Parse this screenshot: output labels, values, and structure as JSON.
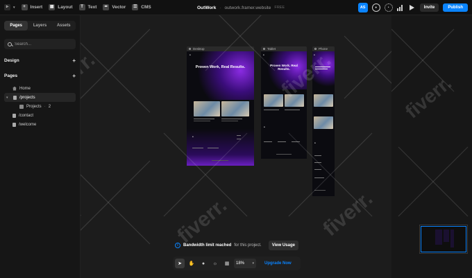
{
  "topbar": {
    "menu": [
      {
        "label": "Insert",
        "icon": "plus-icon"
      },
      {
        "label": "Layout",
        "icon": "layout-icon"
      },
      {
        "label": "Text",
        "icon": "text-icon"
      },
      {
        "label": "Vector",
        "icon": "vector-icon"
      },
      {
        "label": "CMS",
        "icon": "cms-icon"
      }
    ],
    "project_name": "OutWork",
    "domain": "outwork.framer.website",
    "plan": "FREE",
    "avatar": "AS",
    "invite_label": "Invite",
    "publish_label": "Publish"
  },
  "sidebar": {
    "tabs": [
      "Pages",
      "Layers",
      "Assets"
    ],
    "active_tab": "Pages",
    "search_placeholder": "Search...",
    "design_label": "Design",
    "pages_label": "Pages",
    "pages": [
      {
        "label": "Home",
        "icon": "home-icon"
      },
      {
        "label": "/projects",
        "icon": "page-icon",
        "expanded": true,
        "active": true
      },
      {
        "label": "Projects",
        "count": "2",
        "icon": "cms-collection-icon"
      },
      {
        "label": "/contact",
        "icon": "page-icon"
      },
      {
        "label": "/welcome",
        "icon": "page-icon"
      }
    ]
  },
  "canvas": {
    "frames": [
      {
        "label": "Desktop",
        "hero_title": "Proven Work, Real Results."
      },
      {
        "label": "Tablet",
        "hero_title": "Proven Work. Real Results."
      },
      {
        "label": "Phone"
      }
    ]
  },
  "bandwidth": {
    "message_bold": "Bandwidth limit reached",
    "message_rest": "for this project.",
    "button_label": "View Usage"
  },
  "toolbar": {
    "zoom": "18%",
    "upgrade_label": "Upgrade Now"
  },
  "colors": {
    "accent": "#0a84ff",
    "purple": "#8a2be2",
    "canvas": "#1c1c1c"
  }
}
